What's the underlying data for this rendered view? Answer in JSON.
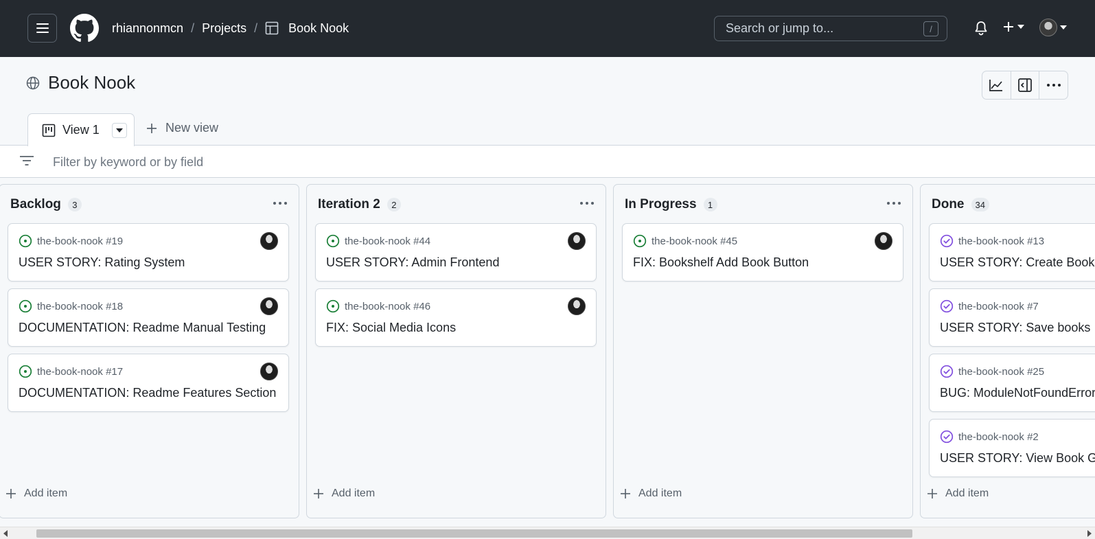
{
  "header": {
    "breadcrumbs": {
      "owner": "rhiannonmcn",
      "projects": "Projects",
      "project": "Book Nook"
    },
    "search_placeholder": "Search or jump to...",
    "search_shortcut": "/"
  },
  "project": {
    "title": "Book Nook"
  },
  "tabs": {
    "active": "View 1",
    "new_view": "New view"
  },
  "filter": {
    "placeholder": "Filter by keyword or by field"
  },
  "columns": [
    {
      "title": "Backlog",
      "count": "3",
      "add_item": "Add item",
      "cards": [
        {
          "ref": "the-book-nook #19",
          "title": "USER STORY: Rating System",
          "status": "open"
        },
        {
          "ref": "the-book-nook #18",
          "title": "DOCUMENTATION: Readme Manual Testing",
          "status": "open"
        },
        {
          "ref": "the-book-nook #17",
          "title": "DOCUMENTATION: Readme Features Section",
          "status": "open"
        }
      ]
    },
    {
      "title": "Iteration 2",
      "count": "2",
      "add_item": "Add item",
      "cards": [
        {
          "ref": "the-book-nook #44",
          "title": "USER STORY: Admin Frontend",
          "status": "open"
        },
        {
          "ref": "the-book-nook #46",
          "title": "FIX: Social Media Icons",
          "status": "open"
        }
      ]
    },
    {
      "title": "In Progress",
      "count": "1",
      "add_item": "Add item",
      "cards": [
        {
          "ref": "the-book-nook #45",
          "title": "FIX: Bookshelf Add Book Button",
          "status": "open"
        }
      ]
    },
    {
      "title": "Done",
      "count": "34",
      "add_item": "Add item",
      "cards": [
        {
          "ref": "the-book-nook #13",
          "title": "USER STORY: Create Book Rev",
          "status": "closed"
        },
        {
          "ref": "the-book-nook #7",
          "title": "USER STORY: Save books",
          "status": "closed"
        },
        {
          "ref": "the-book-nook #25",
          "title": "BUG: ModuleNotFoundError",
          "status": "closed"
        },
        {
          "ref": "the-book-nook #2",
          "title": "USER STORY: View Book Genr",
          "status": "closed"
        }
      ]
    }
  ],
  "colors": {
    "header_bg": "#24292f",
    "open_issue": "#1a7f37",
    "closed_issue": "#8250df"
  }
}
